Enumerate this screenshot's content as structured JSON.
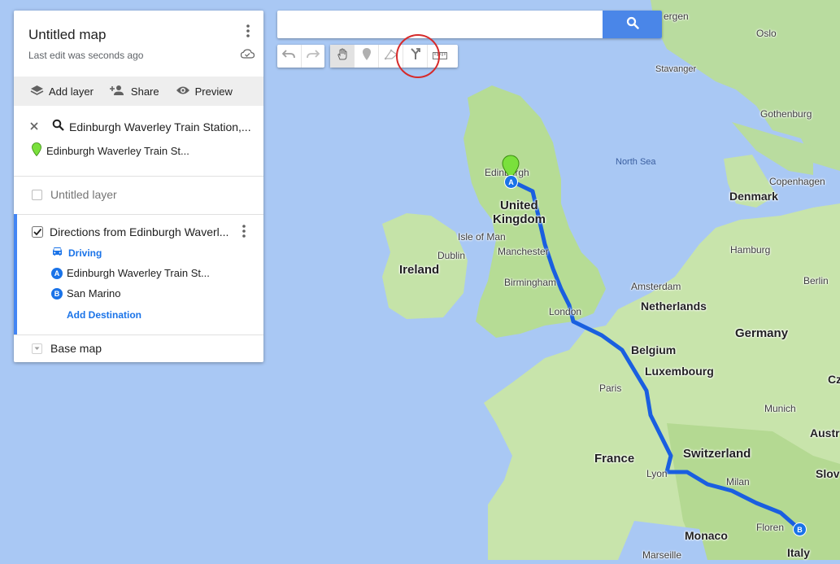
{
  "panel": {
    "title": "Untitled map",
    "last_edit": "Last edit was seconds ago",
    "actions": {
      "add_layer": "Add layer",
      "share": "Share",
      "preview": "Preview"
    },
    "search": {
      "query": "Edinburgh Waverley Train Station,...",
      "result": "Edinburgh Waverley Train St..."
    },
    "layer1": {
      "label": "Untitled layer",
      "checked": false
    },
    "layer2": {
      "label": "Directions from Edinburgh Waverl...",
      "checked": true,
      "mode": "Driving",
      "stops": [
        {
          "badge": "A",
          "label": "Edinburgh Waverley Train St..."
        },
        {
          "badge": "B",
          "label": "San Marino"
        }
      ],
      "add_destination": "Add Destination"
    },
    "base_map": "Base map"
  },
  "search_bar": {
    "value": "",
    "placeholder": ""
  },
  "toolbar": {
    "tools": [
      "undo-icon",
      "redo-icon",
      "hand-icon",
      "marker-icon",
      "draw-line-icon",
      "directions-icon",
      "ruler-icon"
    ],
    "highlighted_tool": "directions-icon"
  },
  "map": {
    "labels": {
      "bergen": "ergen",
      "oslo": "Oslo",
      "stavanger": "Stavanger",
      "gothenburg": "Gothenburg",
      "north_sea": "North Sea",
      "copenhagen": "Copenhagen",
      "denmark": "Denmark",
      "edinburgh": "Edinburgh",
      "uk1": "United",
      "uk2": "Kingdom",
      "isle_of_man": "Isle of Man",
      "manchester": "Manchester",
      "dublin": "Dublin",
      "ireland": "Ireland",
      "hamburg": "Hamburg",
      "amsterdam": "Amsterdam",
      "berlin": "Berlin",
      "netherlands": "Netherlands",
      "birmingham": "Birmingham",
      "london": "London",
      "germany": "Germany",
      "belgium": "Belgium",
      "luxembourg": "Luxembourg",
      "paris": "Paris",
      "munich": "Munich",
      "switzerland": "Switzerland",
      "france": "France",
      "lyon": "Lyon",
      "milan": "Milan",
      "monaco": "Monaco",
      "florence": "Floren",
      "marseille": "Marseille",
      "italy": "Italy",
      "austria": "Austr",
      "slovenia": "Slov",
      "cz": "Cz"
    },
    "route_color": "#1a5fe0",
    "marker_a": "A",
    "marker_b": "B",
    "colors": {
      "water": "#a9c8f4",
      "land": "#c5e3a8",
      "land_dark": "#9fd18a",
      "highlight": "#d62b2b"
    }
  }
}
